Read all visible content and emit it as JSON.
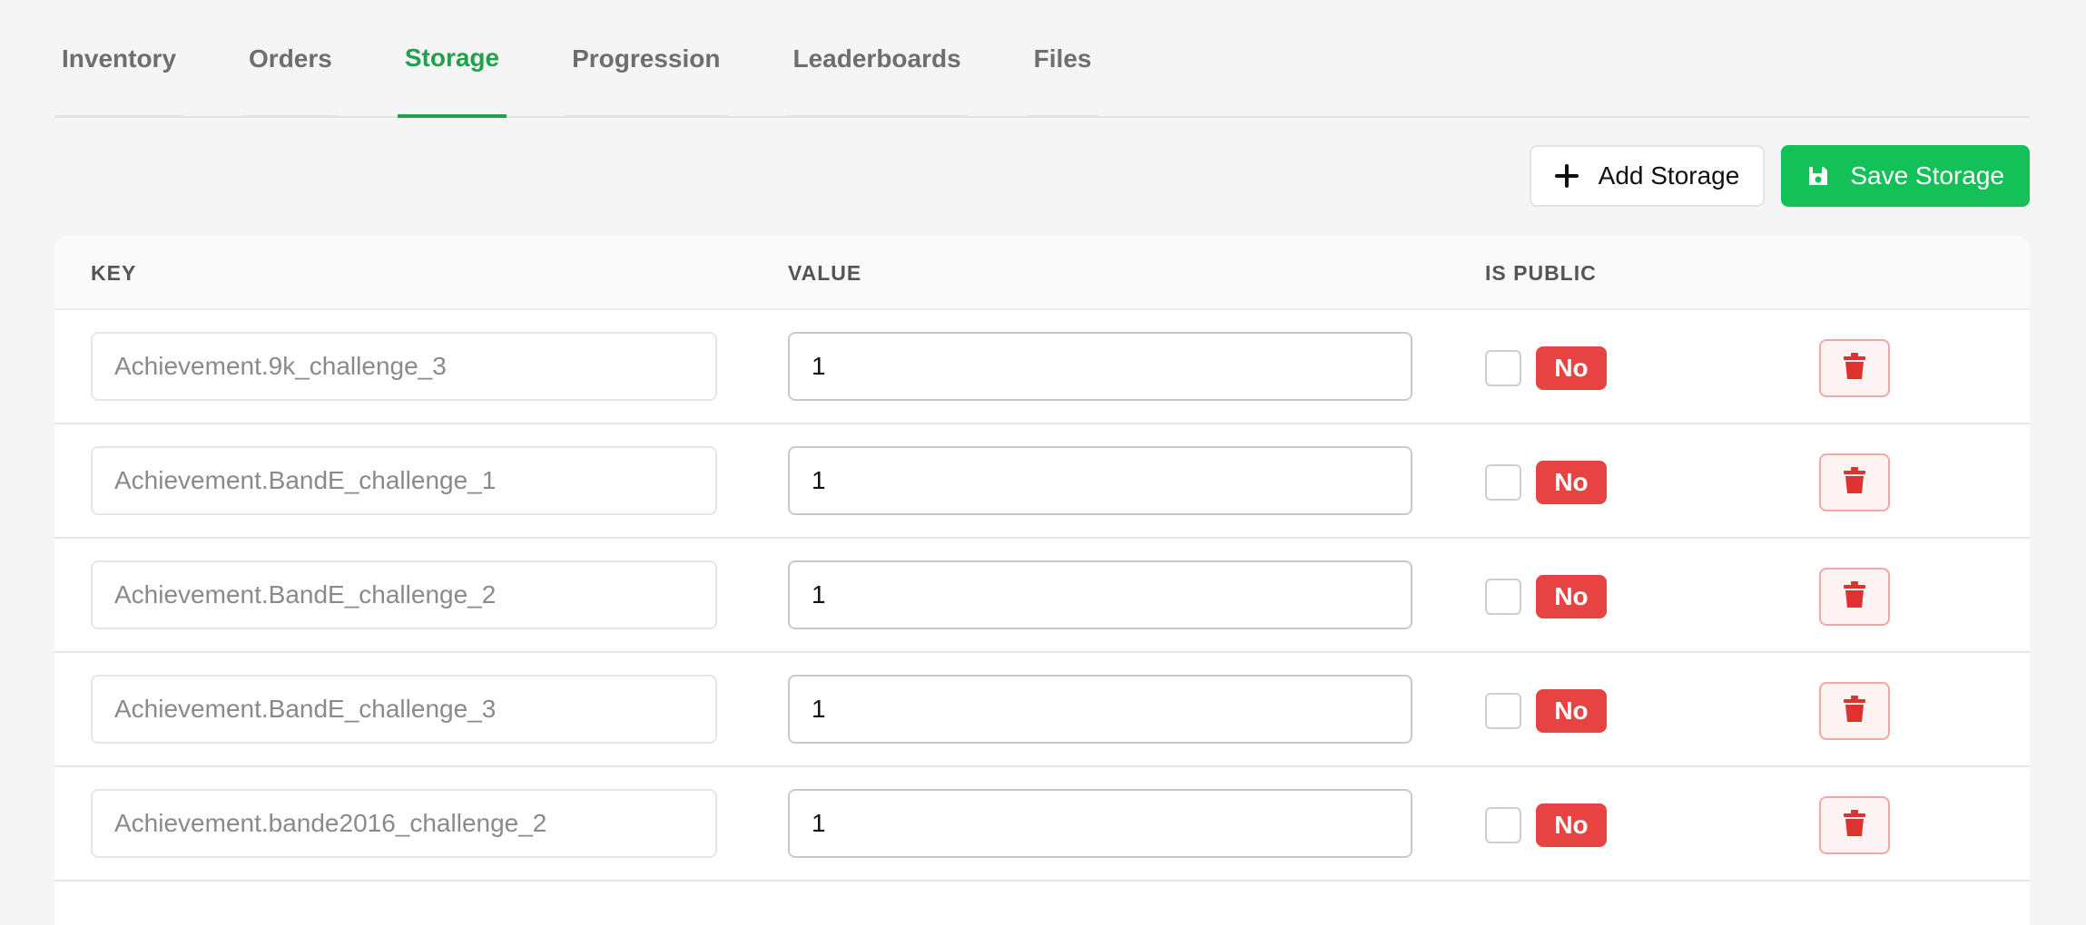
{
  "tabs": [
    {
      "label": "Inventory"
    },
    {
      "label": "Orders"
    },
    {
      "label": "Storage"
    },
    {
      "label": "Progression"
    },
    {
      "label": "Leaderboards"
    },
    {
      "label": "Files"
    }
  ],
  "active_tab": "Storage",
  "toolbar": {
    "add_label": "Add Storage",
    "save_label": "Save Storage",
    "add_icon": "plus-icon",
    "save_icon": "floppy-disk-icon"
  },
  "table": {
    "headers": {
      "key": "KEY",
      "value": "VALUE",
      "is_public": "IS PUBLIC"
    },
    "rows": [
      {
        "key": "Achievement.9k_challenge_3",
        "value": "1",
        "is_public": "No"
      },
      {
        "key": "Achievement.BandE_challenge_1",
        "value": "1",
        "is_public": "No"
      },
      {
        "key": "Achievement.BandE_challenge_2",
        "value": "1",
        "is_public": "No"
      },
      {
        "key": "Achievement.BandE_challenge_3",
        "value": "1",
        "is_public": "No"
      },
      {
        "key": "Achievement.bande2016_challenge_2",
        "value": "1",
        "is_public": "No"
      }
    ]
  },
  "colors": {
    "accent": "#21a04d",
    "save_button": "#13c158",
    "badge_no": "#e74343",
    "delete_icon": "#e03131"
  }
}
